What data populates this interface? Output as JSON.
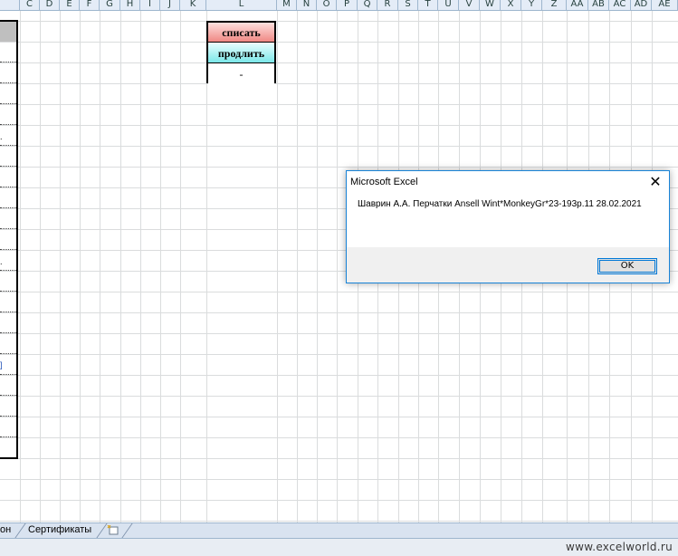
{
  "columns": [
    "C",
    "D",
    "E",
    "F",
    "G",
    "H",
    "I",
    "J",
    "K",
    "L",
    "M",
    "N",
    "O",
    "P",
    "Q",
    "R",
    "S",
    "T",
    "U",
    "V",
    "W",
    "X",
    "Y",
    "Z",
    "AA",
    "AB",
    "AC",
    "AD",
    "AE"
  ],
  "l_column": {
    "write_off_label": "списать",
    "extend_label": "продлить",
    "dash_label": "-"
  },
  "left_table_marks": [
    ".",
    ".",
    "]"
  ],
  "dialog": {
    "title": "Microsoft Excel",
    "message": "Шаврин А.А. Перчатки Ansell Wint*MonkeyGr*23-193р.11 28.02.2021",
    "ok_label": "OK",
    "close_glyph": "✕"
  },
  "sheet_tabs": {
    "partial_tab": "он",
    "certificates_tab": "Сертификаты"
  },
  "watermark": "www.excelworld.ru"
}
